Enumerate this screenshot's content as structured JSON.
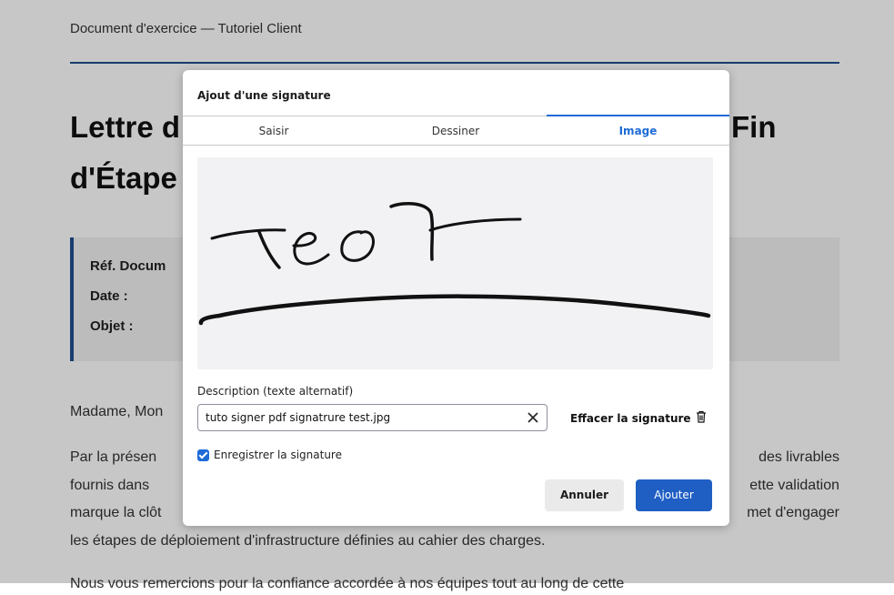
{
  "document": {
    "header": "Document d'exercice — Tutoriel Client",
    "title_line1_left": "Lettre d",
    "title_line1_right": "Fin",
    "title_line2": "d'Étape",
    "ref_labels": [
      "Réf. Docum",
      "Date :",
      "Objet :"
    ],
    "salutation": "Madame, Mon",
    "para1_line1_left": "Par la présen",
    "para1_line1_right": "des livrables",
    "para1_line2_left": "fournis dans",
    "para1_line2_right": "ette validation",
    "para1_line3_left": "marque la clôt",
    "para1_line3_right": "met d'engager",
    "para1_line4": "les étapes de déploiement d'infrastructure définies au cahier des charges.",
    "para2_partial": "Nous vous remercions pour la confiance accordée à nos équipes tout au long de cette"
  },
  "dialog": {
    "title": "Ajout d'une signature",
    "tabs": [
      {
        "label": "Saisir",
        "active": false
      },
      {
        "label": "Dessiner",
        "active": false
      },
      {
        "label": "Image",
        "active": true
      }
    ],
    "description_label": "Description (texte alternatif)",
    "description_value": "tuto signer pdf signatrure test.jpg",
    "clear_icon": "close-icon",
    "erase_label": "Effacer la signature",
    "erase_icon": "trash-icon",
    "save_label": "Enregistrer la signature",
    "save_checked": true,
    "cancel_label": "Annuler",
    "add_label": "Ajouter"
  },
  "colors": {
    "accent": "#1f6bd6",
    "primary_button": "#1f5fc4",
    "document_rule": "#1f4f8f"
  }
}
